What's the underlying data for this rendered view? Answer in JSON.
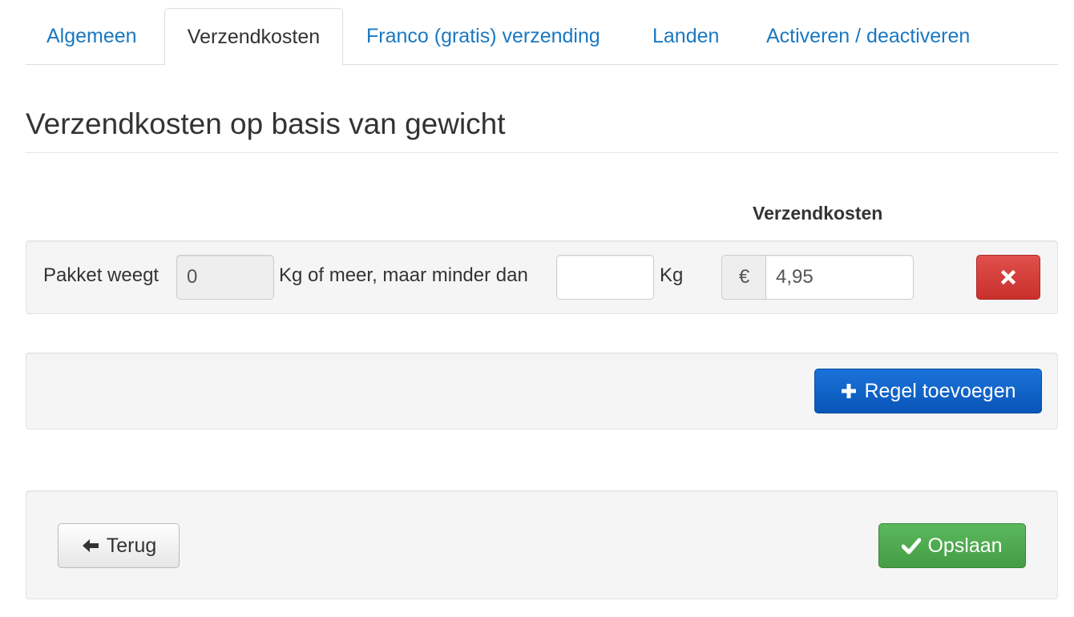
{
  "tabs": [
    {
      "label": "Algemeen",
      "active": false
    },
    {
      "label": "Verzendkosten",
      "active": true
    },
    {
      "label": "Franco (gratis) verzending",
      "active": false
    },
    {
      "label": "Landen",
      "active": false
    },
    {
      "label": "Activeren / deactiveren",
      "active": false
    }
  ],
  "page_title": "Verzendkosten op basis van gewicht",
  "table": {
    "column_header": "Verzendkosten",
    "rows": [
      {
        "prefix_label": "Pakket weegt",
        "min_weight": "0",
        "middle_label": "Kg of meer, maar minder dan",
        "max_weight": "",
        "unit_label": "Kg",
        "currency_symbol": "€",
        "cost": "4,95"
      }
    ]
  },
  "buttons": {
    "add_row": "Regel toevoegen",
    "back": "Terug",
    "save": "Opslaan"
  },
  "icons": {
    "delete": "close-icon",
    "add": "plus-icon",
    "back": "arrow-left-icon",
    "save": "check-icon"
  },
  "colors": {
    "link": "#1a78c2",
    "danger": "#d9534f",
    "primary": "#0a5fc8",
    "success": "#4cae4c"
  }
}
